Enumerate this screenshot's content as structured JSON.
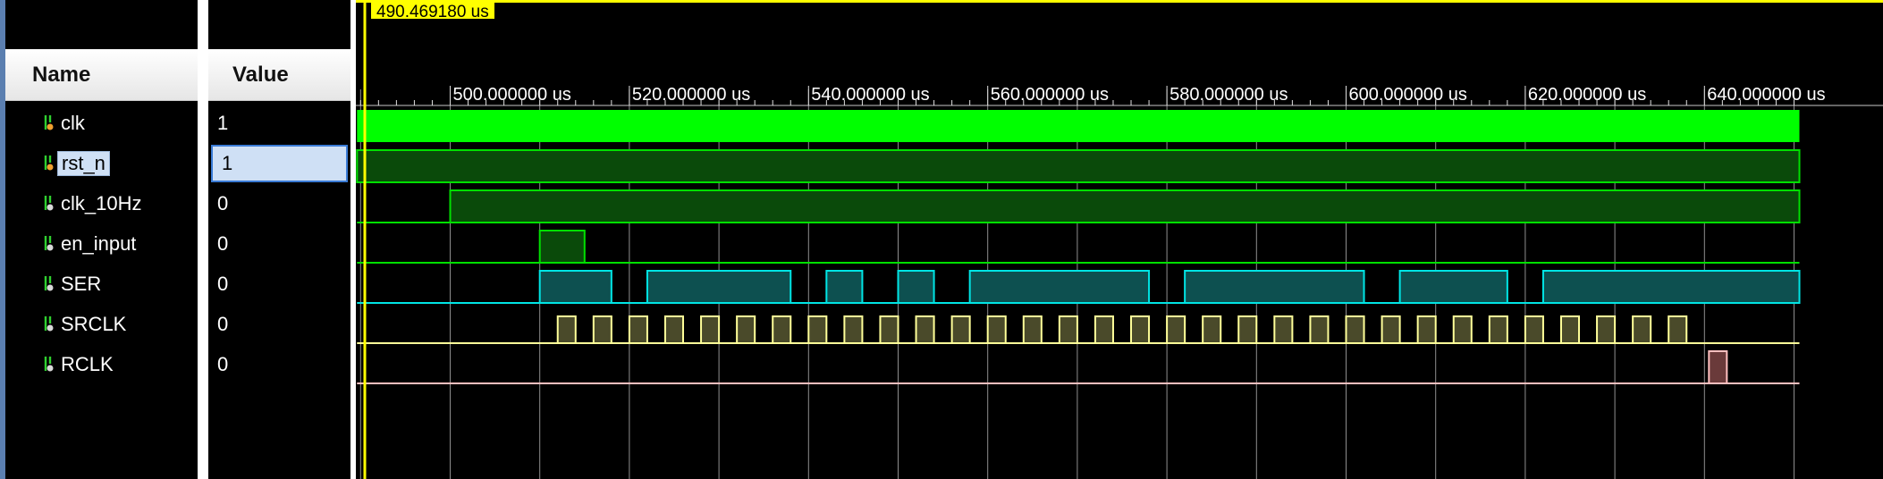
{
  "headers": {
    "name": "Name",
    "value": "Value"
  },
  "cursor": {
    "label": "490.469180 us",
    "time_us": 490.46918
  },
  "timeline": {
    "ticks": [
      {
        "label": "500.000000 us",
        "t": 500
      },
      {
        "label": "520.000000 us",
        "t": 520
      },
      {
        "label": "540.000000 us",
        "t": 540
      },
      {
        "label": "560.000000 us",
        "t": 560
      },
      {
        "label": "580.000000 us",
        "t": 580
      },
      {
        "label": "600.000000 us",
        "t": 600
      },
      {
        "label": "620.000000 us",
        "t": 620
      },
      {
        "label": "640.000000 us",
        "t": 640
      }
    ],
    "grid_step_us": 10,
    "range_us": [
      489.6,
      650.6
    ]
  },
  "signals": [
    {
      "name": "clk",
      "value": "1",
      "icon": "input-port-icon",
      "color": "#00ff00",
      "kind": "fast-clock"
    },
    {
      "name": "rst_n",
      "value": "1",
      "icon": "input-port-icon",
      "color": "#00e000",
      "kind": "bus",
      "high": [
        [
          489.6,
          650.6
        ]
      ],
      "selected": true
    },
    {
      "name": "clk_10Hz",
      "value": "0",
      "icon": "output-port-icon",
      "color": "#00e000",
      "kind": "bus",
      "high": [
        [
          500,
          650.6
        ]
      ]
    },
    {
      "name": "en_input",
      "value": "0",
      "icon": "output-port-icon",
      "color": "#00e000",
      "kind": "bus",
      "high": [
        [
          510,
          515
        ]
      ]
    },
    {
      "name": "SER",
      "value": "0",
      "icon": "output-port-icon",
      "color": "#00e5e5",
      "kind": "bus",
      "high": [
        [
          510,
          518
        ],
        [
          522,
          538
        ],
        [
          542,
          546
        ],
        [
          550,
          554
        ],
        [
          558,
          578
        ],
        [
          582,
          602
        ],
        [
          606,
          618
        ],
        [
          622,
          650.6
        ]
      ]
    },
    {
      "name": "SRCLK",
      "value": "0",
      "icon": "output-port-icon",
      "color": "#ffff99",
      "kind": "pulses",
      "pulses": {
        "start": 512,
        "period": 4,
        "width": 2,
        "count": 32
      }
    },
    {
      "name": "RCLK",
      "value": "0",
      "icon": "output-port-icon",
      "color": "#ffbfbf",
      "kind": "bus",
      "high": [
        [
          640.5,
          642.5
        ]
      ]
    }
  ]
}
